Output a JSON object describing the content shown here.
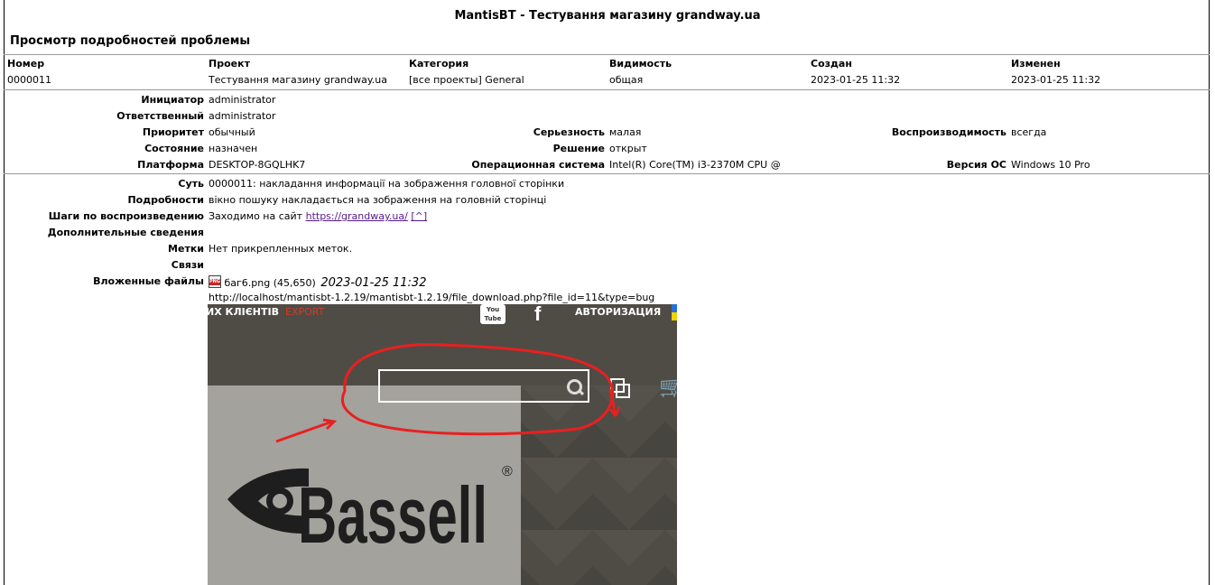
{
  "app_title": "MantisBT - Тестування магазину grandway.ua",
  "section_title": "Просмотр подробностей проблемы",
  "summary_table": {
    "headers": [
      "Номер",
      "Проект",
      "Категория",
      "Видимость",
      "Создан",
      "Изменен"
    ],
    "values": [
      "0000011",
      "Тестування магазину grandway.ua",
      "[все проекты] General",
      "общая",
      "2023-01-25 11:32",
      "2023-01-25 11:32"
    ]
  },
  "details": {
    "reporter_label": "Инициатор",
    "reporter": "administrator",
    "handler_label": "Ответственный",
    "handler": "administrator",
    "priority_label": "Приоритет",
    "priority": "обычный",
    "severity_label": "Серьезность",
    "severity": "малая",
    "reproducibility_label": "Воспроизводимость",
    "reproducibility": "всегда",
    "status_label": "Состояние",
    "status": "назначен",
    "resolution_label": "Решение",
    "resolution": "открыт",
    "platform_label": "Платформа",
    "platform": "DESKTOP-8GQLHK7",
    "os_label": "Операционная система",
    "os": "Intel(R) Core(TM) i3-2370M CPU @",
    "os_version_label": "Версия ОС",
    "os_version": "Windows 10 Pro"
  },
  "description": {
    "summary_label": "Суть",
    "summary": "0000011: накладання информації на зображення головної сторінки",
    "description_label": "Подробности",
    "description": "вікно пошуку накладається на зображення на головній сторінці",
    "steps_label": "Шаги по воспроизведению",
    "steps_prefix": "Заходимо на сайт",
    "steps_link": "https://grandway.ua/",
    "steps_anchor": "[^]",
    "additional_label": "Дополнительные сведения",
    "tags_label": "Метки",
    "tags": "Нет прикрепленных меток.",
    "relations_label": "Связи",
    "attachments_label": "Вложенные файлы",
    "attachment_name": "баг6.png (45,650)",
    "attachment_date": "2023-01-25 11:32",
    "attachment_url": "http://localhost/mantisbt-1.2.19/mantisbt-1.2.19/file_download.php?file_id=11&type=bug",
    "attachment_icon": "png-file-icon"
  },
  "screenshot": {
    "nav_clients": "ИХ КЛІЄНТІВ",
    "nav_export": "EXPORT",
    "youtube_text": "You Tube",
    "login": "АВТОРИЗАЦИЯ",
    "brand": "Bassell",
    "registered": "®",
    "colors": {
      "bg": "#4f4c45",
      "panel": "#a3a29d",
      "accent_red": "#e82020",
      "export_red": "#d9372a"
    }
  }
}
